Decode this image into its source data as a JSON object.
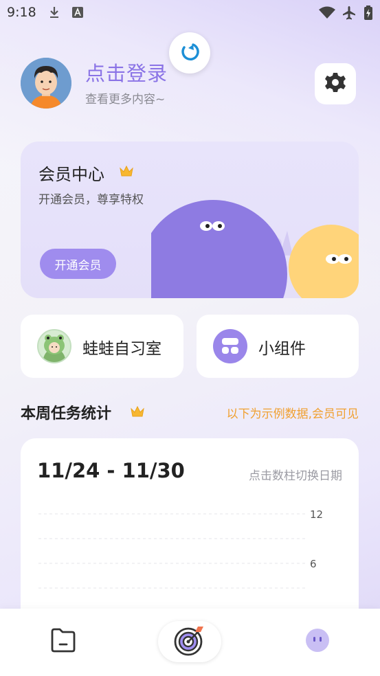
{
  "status_bar": {
    "time": "9:18",
    "left_icons": [
      "download-icon",
      "keyboard-a-icon"
    ],
    "right_icons": [
      "wifi-icon",
      "airplane-mode-icon",
      "battery-charging-icon"
    ]
  },
  "header": {
    "login_title": "点击登录",
    "login_subtitle": "查看更多内容~",
    "refresh_icon": "refresh-icon",
    "settings_icon": "gear-icon"
  },
  "member": {
    "title": "会员中心",
    "subtitle": "开通会员，尊享特权",
    "button_label": "开通会员"
  },
  "shortcuts": [
    {
      "label": "蛙蛙自习室",
      "icon": "frog-avatar-icon"
    },
    {
      "label": "小组件",
      "icon": "widget-icon"
    }
  ],
  "weekly": {
    "title": "本周任务统计",
    "note": "以下为示例数据,会员可见",
    "date_range": "11/24 - 11/30",
    "date_hint": "点击数柱切换日期",
    "y_ticks": [
      "12",
      "6"
    ]
  },
  "colors": {
    "accent": "#8a73e6",
    "member_button": "#9f8cee",
    "note": "#f0a030",
    "purple_blob": "#8e7be2",
    "yellow_blob": "#ffd47a"
  },
  "bottom_nav": [
    {
      "name": "files",
      "icon": "folder-icon"
    },
    {
      "name": "focus",
      "icon": "target-icon"
    },
    {
      "name": "me",
      "icon": "face-icon"
    }
  ]
}
